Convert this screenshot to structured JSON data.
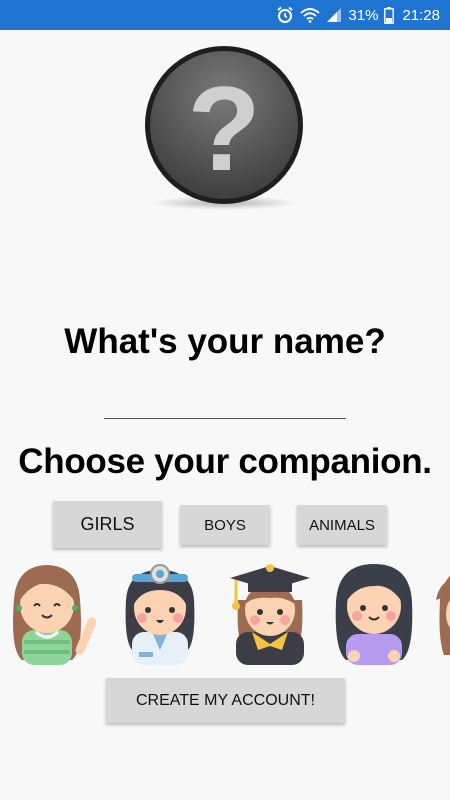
{
  "status_bar": {
    "battery_percent": "31%",
    "time": "21:28",
    "icons": [
      "alarm-icon",
      "wifi-icon",
      "signal-icon",
      "battery-icon"
    ],
    "color": "#1f74d2"
  },
  "avatar": {
    "icon": "question-mark-icon",
    "symbol": "?"
  },
  "name_prompt": {
    "heading": "What's your name?",
    "input_value": "",
    "input_placeholder": ""
  },
  "companion": {
    "heading": "Choose your companion.",
    "tabs": [
      {
        "label": "GIRLS",
        "selected": true
      },
      {
        "label": "BOYS",
        "selected": false
      },
      {
        "label": "ANIMALS",
        "selected": false
      }
    ],
    "characters": [
      {
        "name": "girl-green-dress-icon"
      },
      {
        "name": "girl-doctor-icon"
      },
      {
        "name": "girl-graduate-icon"
      },
      {
        "name": "girl-purple-shirt-icon"
      },
      {
        "name": "girl-partial-icon"
      }
    ]
  },
  "create_button": {
    "label": "CREATE MY ACCOUNT!"
  }
}
